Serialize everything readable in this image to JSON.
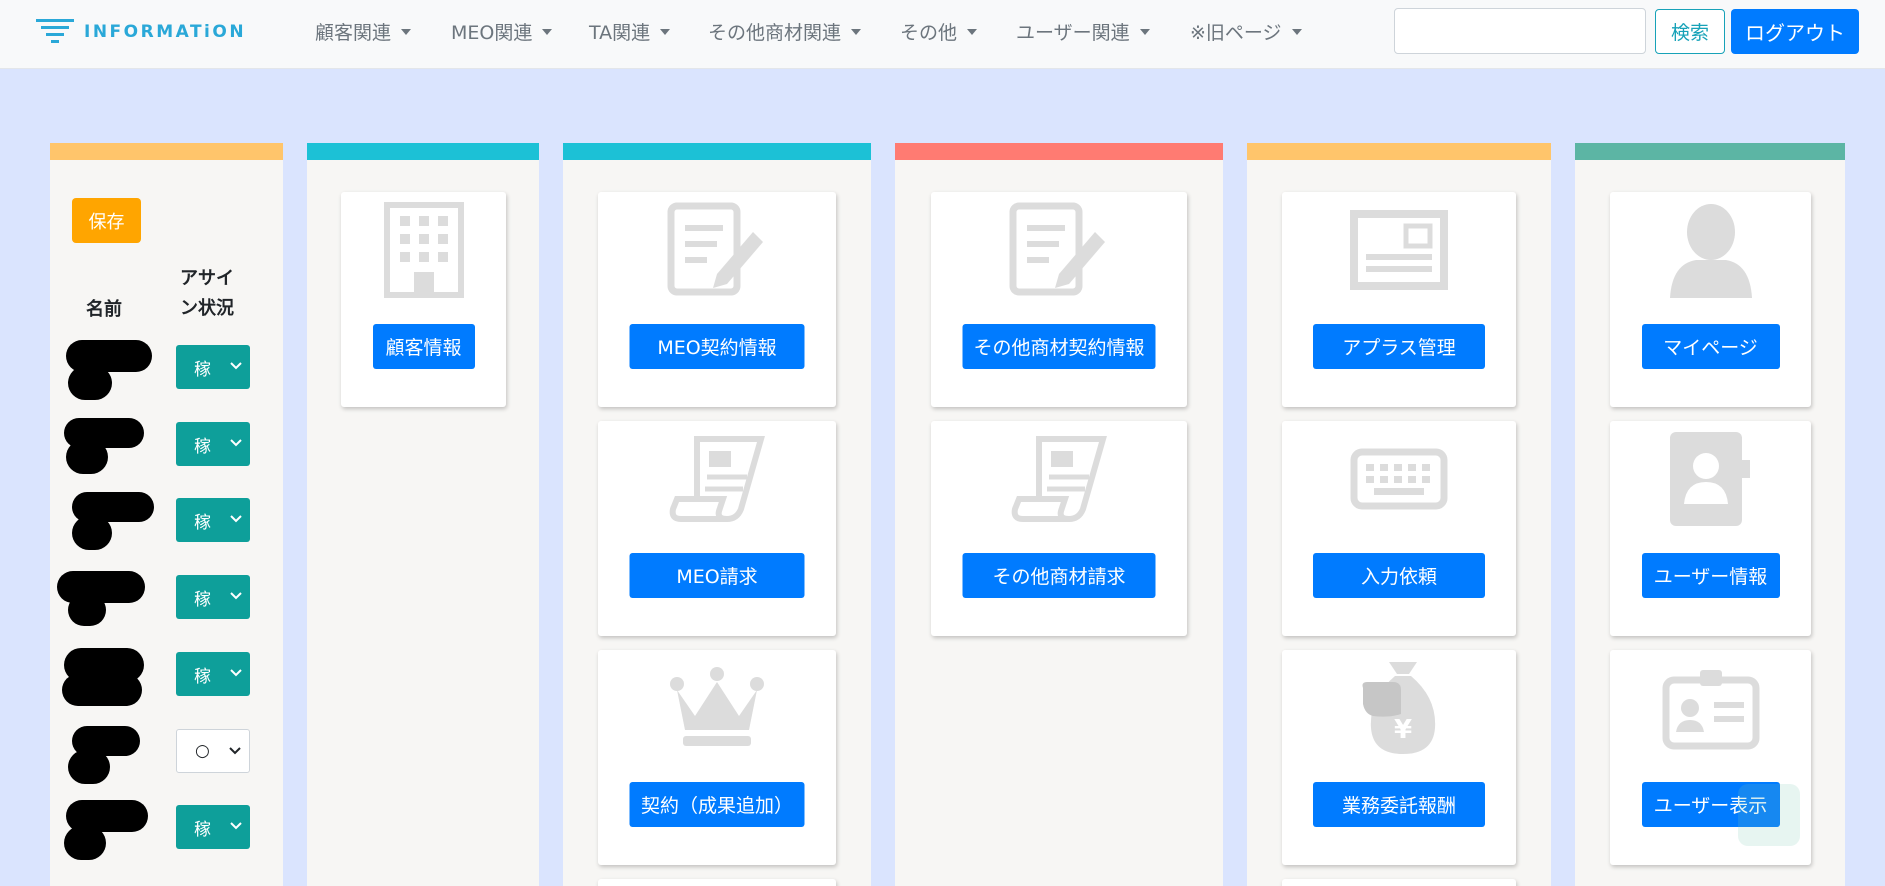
{
  "navbar": {
    "logo_text": "INFORMATiON",
    "menus": [
      "顧客関連",
      "MEO関連",
      "TA関連",
      "その他商材関連",
      "その他",
      "ユーザー関連",
      "※旧ページ"
    ],
    "search_placeholder": "",
    "search_label": "検索",
    "logout_label": "ログアウト"
  },
  "assign_panel": {
    "save_label": "保存",
    "header_name": "名前",
    "header_assign": "アサイン状況",
    "rows": [
      {
        "status": "稼"
      },
      {
        "status": "稼"
      },
      {
        "status": "稼"
      },
      {
        "status": "稼"
      },
      {
        "status": "稼"
      },
      {
        "status": "○"
      },
      {
        "status": "稼"
      }
    ]
  },
  "columns": [
    {
      "bar_color": "#ffc56b",
      "cards": []
    },
    {
      "bar_color": "#1cc1d6",
      "cards": [
        {
          "icon": "building-icon",
          "label": "顧客情報"
        }
      ]
    },
    {
      "bar_color": "#1cc1d6",
      "cards": [
        {
          "icon": "contract-edit-icon",
          "label": "MEO契約情報"
        },
        {
          "icon": "invoice-scroll-icon",
          "label": "MEO請求"
        },
        {
          "icon": "crown-icon",
          "label": "契約（成果追加）"
        }
      ]
    },
    {
      "bar_color": "#ff7b72",
      "cards": [
        {
          "icon": "contract-edit-icon",
          "label": "その他商材契約情報"
        },
        {
          "icon": "invoice-scroll-icon",
          "label": "その他商材請求"
        }
      ]
    },
    {
      "bar_color": "#ffc56b",
      "cards": [
        {
          "icon": "newspaper-icon",
          "label": "アプラス管理"
        },
        {
          "icon": "keyboard-icon",
          "label": "入力依頼"
        },
        {
          "icon": "money-bag-yen-icon",
          "label": "業務委託報酬"
        }
      ]
    },
    {
      "bar_color": "#5cb5a4",
      "cards": [
        {
          "icon": "user-silhouette-icon",
          "label": "マイページ"
        },
        {
          "icon": "address-book-icon",
          "label": "ユーザー情報"
        },
        {
          "icon": "id-card-icon",
          "label": "ユーザー表示"
        }
      ]
    }
  ]
}
